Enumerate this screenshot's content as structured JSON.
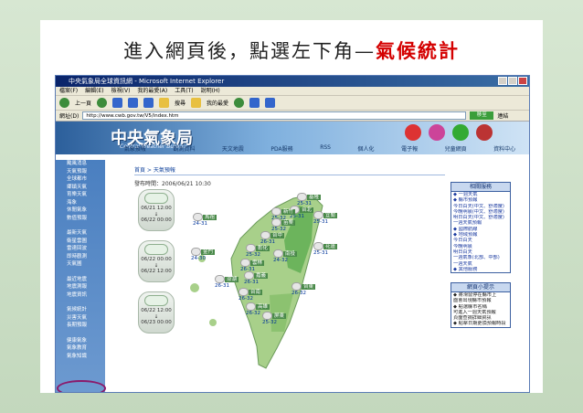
{
  "slide": {
    "title_prefix": "進入網頁後，點選左下角",
    "title_dash": "—",
    "title_highlight": "氣候統計"
  },
  "browser": {
    "window_title": "中央氣象局全球資訊網 - Microsoft Internet Explorer",
    "menu": [
      "檔案(F)",
      "編輯(E)",
      "檢視(V)",
      "我的最愛(A)",
      "工具(T)",
      "說明(H)"
    ],
    "back_label": "上一頁",
    "search_label": "搜尋",
    "favorites_label": "我的最愛",
    "address_label": "網址(D)",
    "address_value": "http://www.cwb.gov.tw/V5/index.htm",
    "go_label": "移至",
    "links_label": "連結"
  },
  "site": {
    "logo": "中央氣象局",
    "logo_sub": "Central Weather Bureau",
    "nav": [
      "氣象預報",
      "觀測資料",
      "天文地震",
      "PDA服務",
      "RSS",
      "個人化",
      "電子報",
      "兒童網頁",
      "資料中心"
    ],
    "top_icons": [
      "English",
      "繁體中文",
      "網站導覽",
      "意見信箱"
    ]
  },
  "sidebar": {
    "groups": [
      [
        "颱風消息",
        "天氣預報",
        "全球都市",
        "鄉鎮天氣",
        "育樂天氣",
        "海象",
        "休閒氣象",
        "數值預報"
      ],
      [
        "最新天氣",
        "衛星雲圖",
        "雷達回波",
        "即時觀測",
        "天氣圖"
      ],
      [
        "最近地震",
        "地震測報",
        "地震資訊"
      ],
      [
        "氣候統計",
        "災害天氣",
        "長期預報"
      ],
      [
        "健康氣象",
        "氣象教育",
        "氣象知識"
      ]
    ],
    "highlighted": "氣候統計"
  },
  "main": {
    "breadcrumb": "首頁 > 天氣預報",
    "issued_time": "發布時間：2006/06/21 10:30",
    "periods": [
      {
        "line1": "06/21 12:00",
        "line2": "06/22 00:00"
      },
      {
        "line1": "06/22 00:00",
        "line2": "06/22 12:00"
      },
      {
        "line1": "06/22 12:00",
        "line2": "06/23 00:00"
      }
    ],
    "cities": [
      {
        "name": "基隆",
        "temp": "25-31"
      },
      {
        "name": "台北",
        "temp": "25-31"
      },
      {
        "name": "新竹",
        "temp": "25-32"
      },
      {
        "name": "苗栗",
        "temp": "25-32"
      },
      {
        "name": "台中",
        "temp": "26-31"
      },
      {
        "name": "彰化",
        "temp": "25-32"
      },
      {
        "name": "南投",
        "temp": "24-32"
      },
      {
        "name": "雲林",
        "temp": "26-31"
      },
      {
        "name": "嘉義",
        "temp": "26-31"
      },
      {
        "name": "台南",
        "temp": "26-32"
      },
      {
        "name": "高雄",
        "temp": "26-32"
      },
      {
        "name": "屏東",
        "temp": "25-32"
      },
      {
        "name": "宜蘭",
        "temp": "25-31"
      },
      {
        "name": "花蓮",
        "temp": "25-31"
      },
      {
        "name": "台東",
        "temp": "26-32"
      },
      {
        "name": "澎湖",
        "temp": "26-31"
      },
      {
        "name": "金門",
        "temp": "24-30"
      },
      {
        "name": "馬祖",
        "temp": "24-31"
      }
    ],
    "related_header": "相關服務",
    "related_links": [
      "◆ 一週天氣",
      "◆ 縣市預報",
      "今日白天(中文、舒適度)",
      "今晚明晨(中文、舒適度)",
      "明日白天(中文、舒適度)",
      "一週天氣預報",
      "◆ 國際航線",
      "◆ 地域預報",
      "今日白天",
      "今晚明晨",
      "明日白天",
      "一週氣象(北部、中部)",
      "一週天氣",
      "◆ 其他服務"
    ],
    "tips_header": "網頁小提示",
    "tips_lines": [
      "◆ 將滑鼠停在縣市上",
      "面會出現縣市預報",
      "◆ 點選縣市名稱",
      "可進入一週天氣預報",
      "頁面查詢詳細資訊",
      "◆ 點擊日期更換預報時段"
    ]
  }
}
